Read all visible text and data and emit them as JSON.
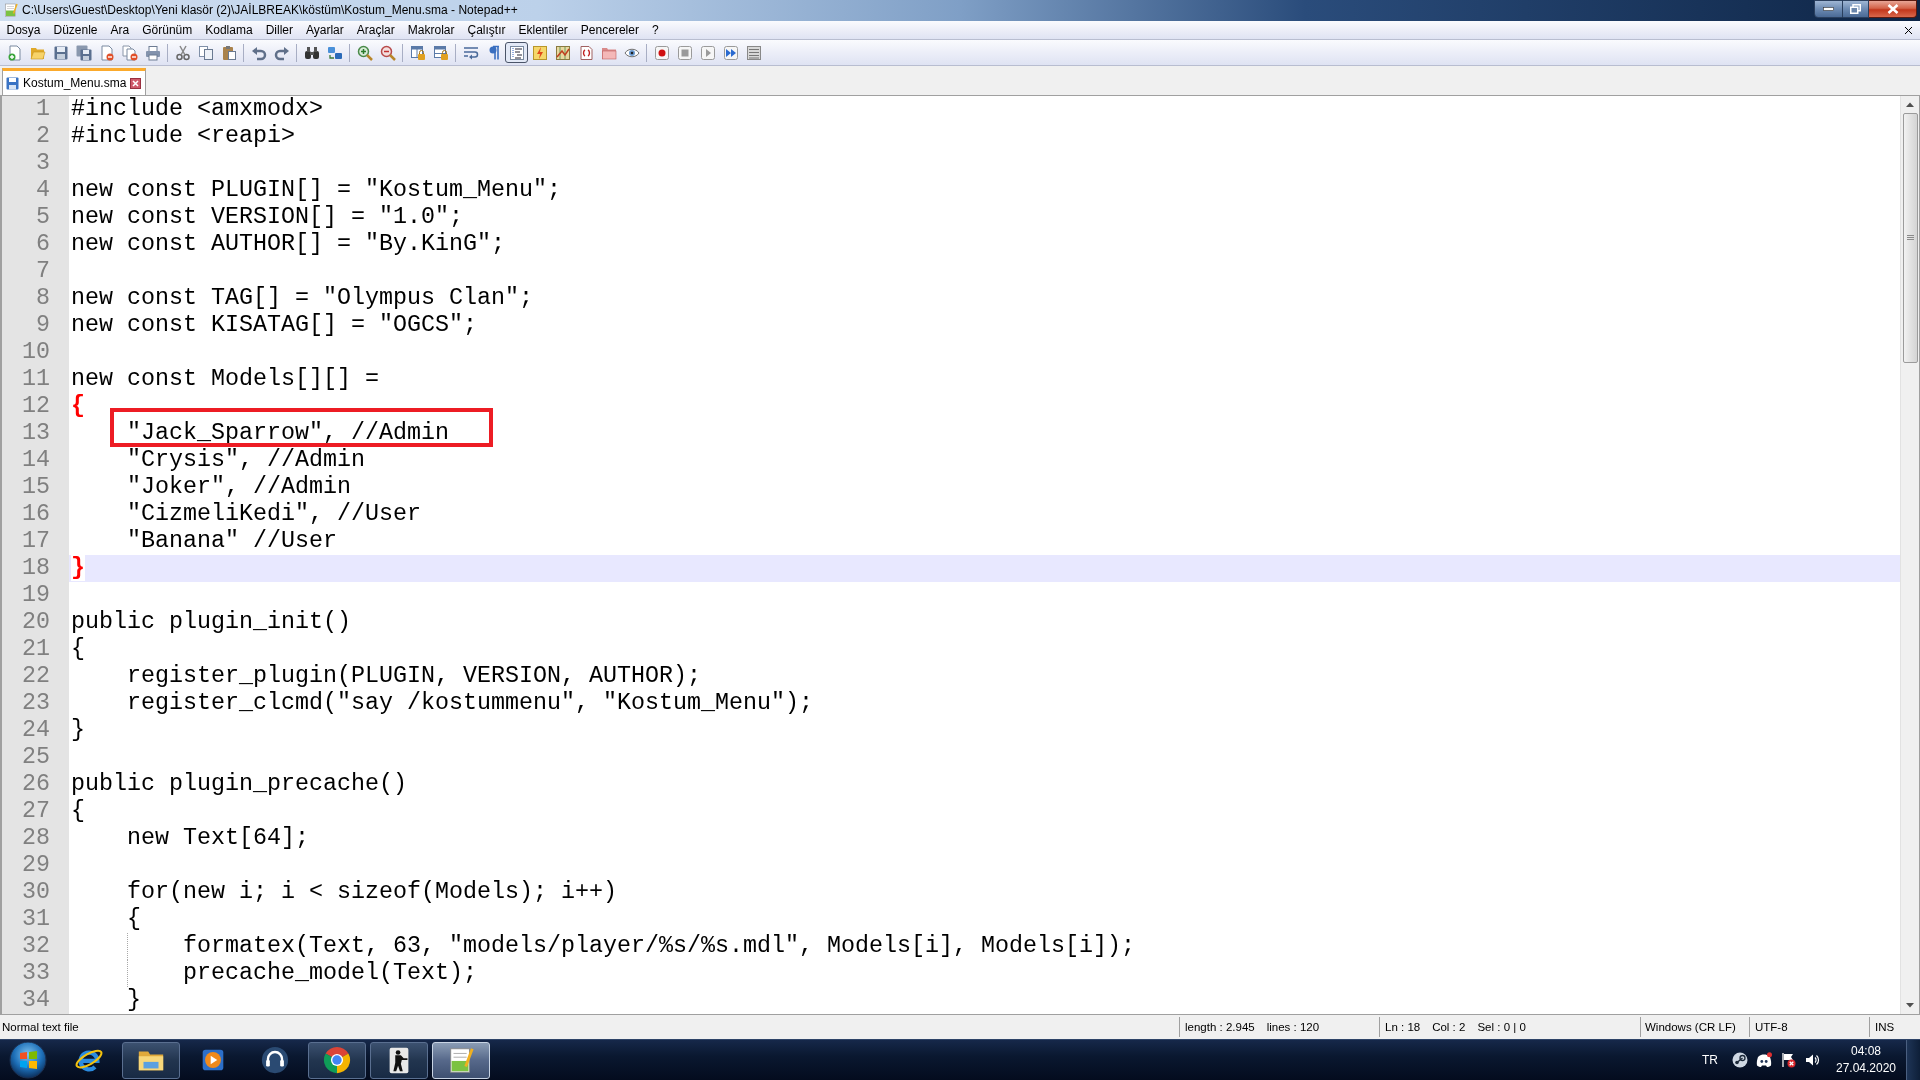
{
  "window": {
    "title": "C:\\Users\\Guest\\Desktop\\Yeni klasör (2)\\JAİLBREAK\\köstüm\\Kostum_Menu.sma - Notepad++"
  },
  "menu_bar": [
    "Dosya",
    "Düzenle",
    "Ara",
    "Görünüm",
    "Kodlama",
    "Diller",
    "Ayarlar",
    "Araçlar",
    "Makrolar",
    "Çalıştır",
    "Eklentiler",
    "Pencereler",
    "?"
  ],
  "toolbar": [
    [
      {
        "kind": "new",
        "pressed": false
      },
      {
        "kind": "open",
        "pressed": false
      },
      {
        "kind": "save",
        "pressed": false
      },
      {
        "kind": "saveall",
        "pressed": false
      },
      {
        "kind": "close",
        "pressed": false
      },
      {
        "kind": "closeall",
        "pressed": false
      },
      {
        "kind": "print",
        "pressed": false
      }
    ],
    [
      {
        "kind": "cut",
        "pressed": false
      },
      {
        "kind": "copy",
        "pressed": false
      },
      {
        "kind": "paste",
        "pressed": false
      }
    ],
    [
      {
        "kind": "undo",
        "pressed": false
      },
      {
        "kind": "redo",
        "pressed": false
      }
    ],
    [
      {
        "kind": "find",
        "pressed": false
      },
      {
        "kind": "replace",
        "pressed": false
      }
    ],
    [
      {
        "kind": "zoomin",
        "pressed": false
      },
      {
        "kind": "zoomout",
        "pressed": false
      }
    ],
    [
      {
        "kind": "syncv",
        "pressed": false
      },
      {
        "kind": "synch",
        "pressed": false
      }
    ],
    [
      {
        "kind": "wrap",
        "pressed": false
      },
      {
        "kind": "allchars",
        "pressed": false
      },
      {
        "kind": "indentguide",
        "pressed": true
      },
      {
        "kind": "udl",
        "pressed": false
      },
      {
        "kind": "docmap",
        "pressed": false
      },
      {
        "kind": "funclist",
        "pressed": false
      },
      {
        "kind": "workspace",
        "pressed": false
      },
      {
        "kind": "monitor",
        "pressed": false
      }
    ],
    [
      {
        "kind": "record",
        "pressed": false
      },
      {
        "kind": "stop",
        "pressed": false
      },
      {
        "kind": "play",
        "pressed": false
      },
      {
        "kind": "playmulti",
        "pressed": false
      },
      {
        "kind": "savemacro",
        "pressed": false
      }
    ]
  ],
  "tabs": [
    {
      "label": "Kostum_Menu.sma",
      "selected": true
    }
  ],
  "editor": {
    "lines": [
      {
        "number": "1",
        "text": "#include <amxmodx>",
        "current": false,
        "brace_match": false,
        "boxed": false
      },
      {
        "number": "2",
        "text": "#include <reapi>",
        "current": false,
        "brace_match": false,
        "boxed": false
      },
      {
        "number": "3",
        "current": false,
        "boxed": false
      },
      {
        "number": "4",
        "text": "new const PLUGIN[] = \"Kostum_Menu\";",
        "current": false,
        "brace_match": false,
        "boxed": false
      },
      {
        "number": "5",
        "text": "new const VERSION[] = \"1.0\";",
        "current": false,
        "brace_match": false,
        "boxed": false
      },
      {
        "number": "6",
        "text": "new const AUTHOR[] = \"By.KinG\";",
        "current": false,
        "brace_match": false,
        "boxed": false
      },
      {
        "number": "7",
        "current": false,
        "boxed": false
      },
      {
        "number": "8",
        "text": "new const TAG[] = \"Olympus Clan\";",
        "current": false,
        "brace_match": false,
        "boxed": false
      },
      {
        "number": "9",
        "text": "new const KISATAG[] = \"OGCS\";",
        "current": false,
        "brace_match": false,
        "boxed": false
      },
      {
        "number": "10",
        "current": false,
        "boxed": false
      },
      {
        "number": "11",
        "text": "new const Models[][] =",
        "current": false,
        "brace_match": false,
        "boxed": false
      },
      {
        "number": "12",
        "text": "{",
        "current": false,
        "brace_match": true,
        "boxed": false
      },
      {
        "number": "13",
        "text": "    \"Jack_Sparrow\", //Admin",
        "current": false,
        "brace_match": false,
        "boxed": true
      },
      {
        "number": "14",
        "text": "    \"Crysis\", //Admin",
        "current": false,
        "brace_match": false,
        "boxed": false
      },
      {
        "number": "15",
        "text": "    \"Joker\", //Admin",
        "current": false,
        "brace_match": false,
        "boxed": false
      },
      {
        "number": "16",
        "text": "    \"CizmeliKedi\", //User",
        "current": false,
        "brace_match": false,
        "boxed": false
      },
      {
        "number": "17",
        "text": "    \"Banana\" //User",
        "current": false,
        "brace_match": false,
        "boxed": false
      },
      {
        "number": "18",
        "text": "}",
        "current": true,
        "brace_match": true,
        "boxed": false
      },
      {
        "number": "19",
        "current": false,
        "boxed": false
      },
      {
        "number": "20",
        "text": "public plugin_init()",
        "current": false,
        "brace_match": false,
        "boxed": false
      },
      {
        "number": "21",
        "text": "{",
        "current": false,
        "brace_match": false,
        "boxed": false
      },
      {
        "number": "22",
        "text": "    register_plugin(PLUGIN, VERSION, AUTHOR);",
        "current": false,
        "brace_match": false,
        "boxed": false
      },
      {
        "number": "23",
        "text": "    register_clcmd(\"say /kostummenu\", \"Kostum_Menu\");",
        "current": false,
        "brace_match": false,
        "boxed": false
      },
      {
        "number": "24",
        "text": "}",
        "current": false,
        "brace_match": false,
        "boxed": false
      },
      {
        "number": "25",
        "current": false,
        "boxed": false
      },
      {
        "number": "26",
        "text": "public plugin_precache()",
        "current": false,
        "brace_match": false,
        "boxed": false
      },
      {
        "number": "27",
        "text": "{",
        "current": false,
        "brace_match": false,
        "boxed": false
      },
      {
        "number": "28",
        "text": "    new Text[64];",
        "current": false,
        "brace_match": false,
        "boxed": false
      },
      {
        "number": "29",
        "current": false,
        "boxed": false
      },
      {
        "number": "30",
        "text": "    for(new i; i < sizeof(Models); i++)",
        "current": false,
        "brace_match": false,
        "boxed": false
      },
      {
        "number": "31",
        "text": "    {",
        "current": false,
        "brace_match": false,
        "boxed": false
      },
      {
        "number": "32",
        "text": "        formatex(Text, 63, \"models/player/%s/%s.mdl\", Models[i], Models[i]);",
        "current": false,
        "brace_match": false,
        "boxed": false
      },
      {
        "number": "33",
        "text": "        precache_model(Text);",
        "current": false,
        "brace_match": false,
        "boxed": false
      },
      {
        "number": "34",
        "text": "    }",
        "current": false,
        "brace_match": false,
        "boxed": false
      }
    ]
  },
  "status_bar": {
    "file_type": "Normal text file",
    "length": "length : 2.945",
    "lines": "lines : 120",
    "line": "Ln : 18",
    "column": "Col : 2",
    "selection": "Sel : 0 | 0",
    "line_ending": "Windows (CR LF)",
    "encoding": "UTF-8",
    "mode": "INS"
  },
  "taskbar": {
    "apps": [
      {
        "kind": "ebrowser",
        "running": false,
        "active": false
      },
      {
        "kind": "explorer",
        "running": true,
        "active": false
      },
      {
        "kind": "media",
        "running": false,
        "active": false
      },
      {
        "kind": "headset",
        "running": false,
        "active": false
      },
      {
        "kind": "chrome",
        "running": true,
        "active": false
      },
      {
        "kind": "soldier",
        "running": true,
        "active": false
      },
      {
        "kind": "notepad",
        "running": true,
        "active": true
      }
    ],
    "tray": {
      "language": "TR",
      "time": "04:08",
      "date": "27.04.2020"
    }
  }
}
